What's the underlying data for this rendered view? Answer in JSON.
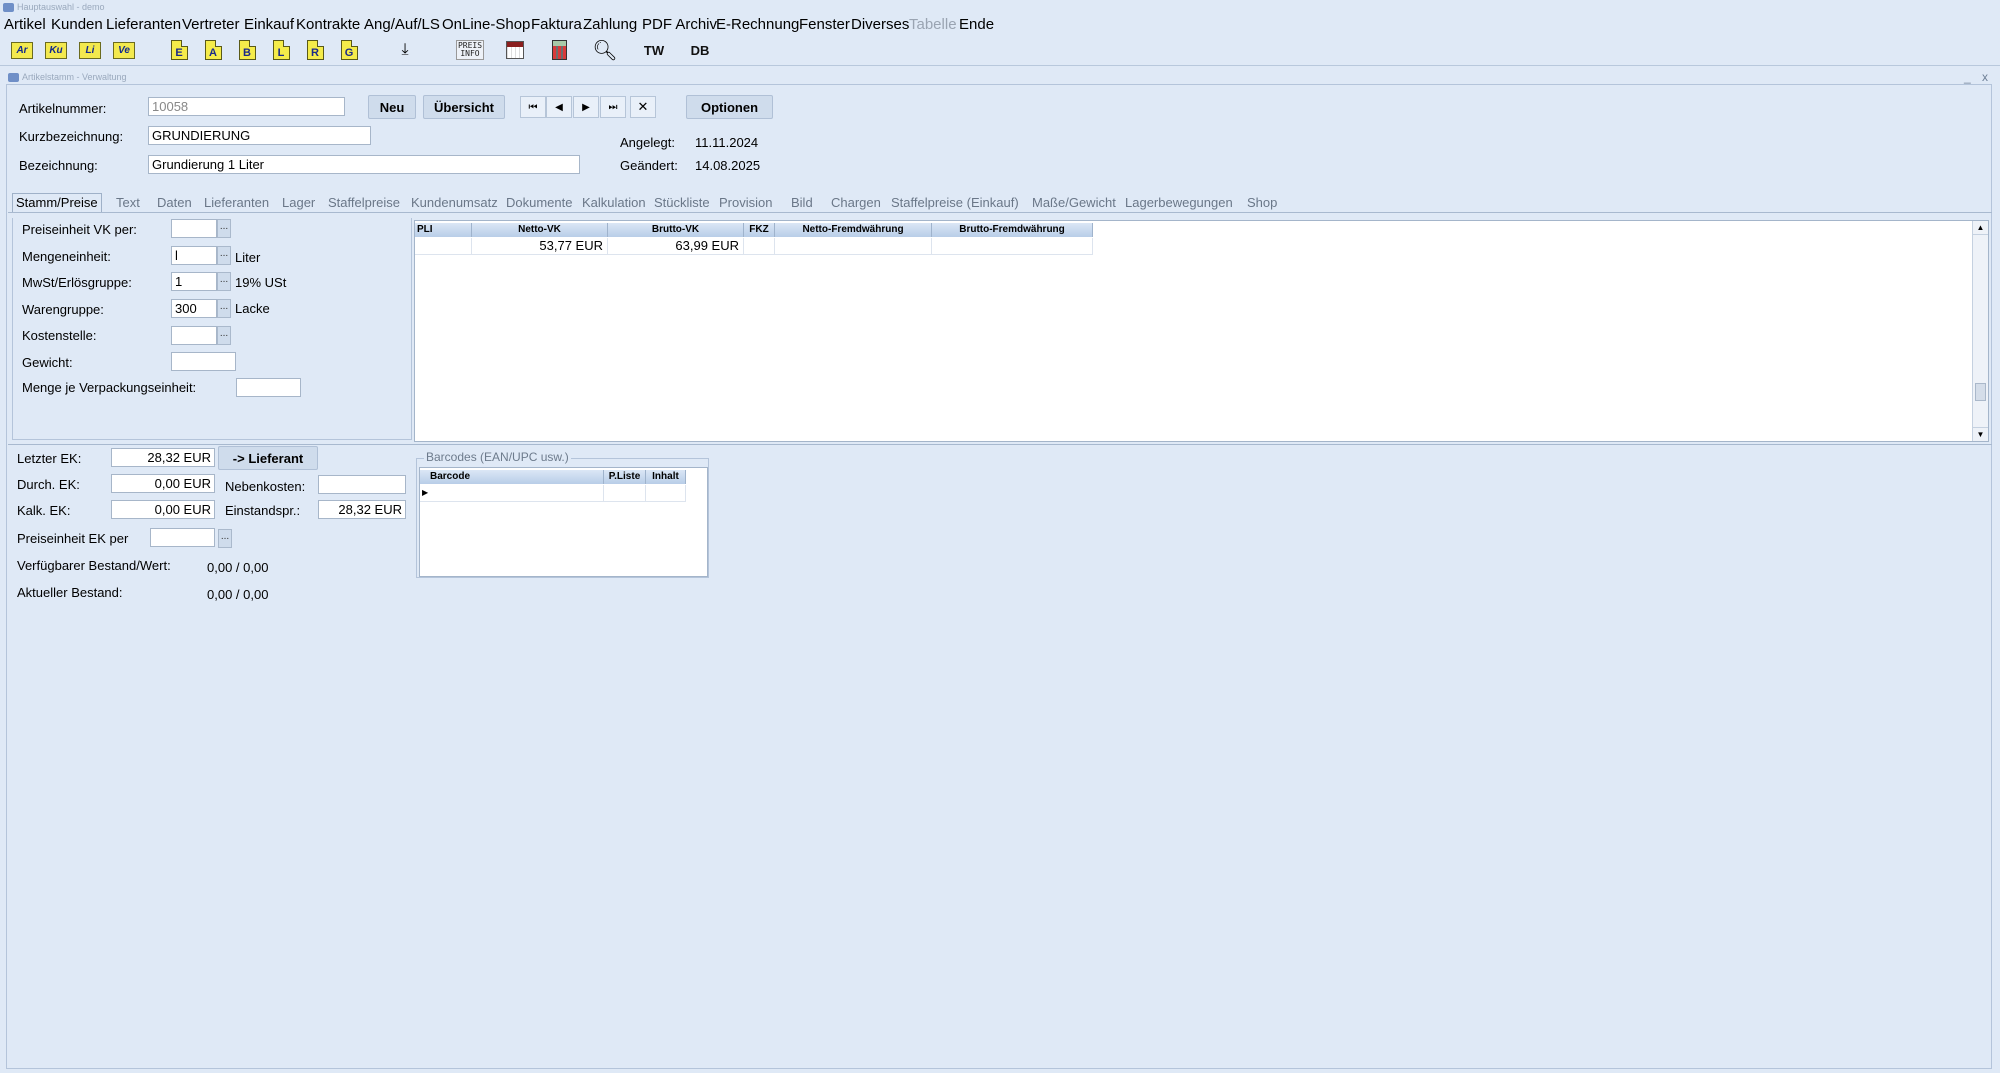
{
  "app": {
    "title": "Hauptauswahl - demo"
  },
  "menu": [
    "Artikel",
    "Kunden",
    "Lieferanten",
    "Vertreter",
    "Einkauf",
    "Kontrakte",
    "Ang/Auf/LS",
    "OnLine-Shop",
    "Faktura",
    "Zahlung",
    "PDF Archiv",
    "E-Rechnung",
    "Fenster",
    "Diverses",
    "Tabelle",
    "Ende"
  ],
  "toolbar": {
    "ar": "Ar",
    "ku": "Ku",
    "li": "Li",
    "ve": "Ve",
    "e": "E",
    "a": "A",
    "b": "B",
    "l": "L",
    "r": "R",
    "g": "G",
    "preis": "PREIS",
    "info": "INFO",
    "tw": "TW",
    "db": "DB"
  },
  "window": {
    "title": "Artikelstamm - Verwaltung",
    "minimize": "_",
    "close": "x"
  },
  "header": {
    "artikelnummer_label": "Artikelnummer:",
    "artikelnummer": "10058",
    "kurz_label": "Kurzbezeichnung:",
    "kurz": "GRUNDIERUNG",
    "bez_label": "Bezeichnung:",
    "bez": "Grundierung 1 Liter",
    "neu": "Neu",
    "uebersicht": "Übersicht",
    "optionen": "Optionen",
    "angelegt_label": "Angelegt:",
    "angelegt": "11.11.2024",
    "geaendert_label": "Geändert:",
    "geaendert": "14.08.2025"
  },
  "tabs": [
    "Stamm/Preise",
    "Text",
    "Daten",
    "Lieferanten",
    "Lager",
    "Staffelpreise",
    "Kundenumsatz",
    "Dokumente",
    "Kalkulation",
    "Stückliste",
    "Provision",
    "Bild",
    "Chargen",
    "Staffelpreise (Einkauf)",
    "Maße/Gewicht",
    "Lagerbewegungen",
    "Shop"
  ],
  "stamm": {
    "pe_vk_label": "Preiseinheit VK per:",
    "pe_vk": "",
    "me_label": "Mengeneinheit:",
    "me": "l",
    "me_text": "Liter",
    "mwst_label": "MwSt/Erlösgruppe:",
    "mwst": "1",
    "mwst_text": "19% USt",
    "wg_label": "Warengruppe:",
    "wg": "300",
    "wg_text": "Lacke",
    "ks_label": "Kostenstelle:",
    "ks": "",
    "gewicht_label": "Gewicht:",
    "gewicht": "",
    "menge_label": "Menge je Verpackungseinheit:",
    "menge": ""
  },
  "price_table": {
    "columns": [
      "PLI",
      "Netto-VK",
      "Brutto-VK",
      "FKZ",
      "Netto-Fremdwährung",
      "Brutto-Fremdwährung"
    ],
    "rows": [
      [
        "",
        "53,77 EUR",
        "63,99 EUR",
        "",
        "",
        ""
      ]
    ]
  },
  "einkauf": {
    "letzter_label": "Letzter EK:",
    "letzter": "28,32 EUR",
    "lieferant_btn": "-> Lieferant",
    "durch_label": "Durch. EK:",
    "durch": "0,00 EUR",
    "neben_label": "Nebenkosten:",
    "neben": "",
    "kalk_label": "Kalk. EK:",
    "kalk": "0,00 EUR",
    "einstand_label": "Einstandspr.:",
    "einstand": "28,32 EUR",
    "pe_ek_label": "Preiseinheit  EK per",
    "pe_ek": "",
    "verf_label": "Verfügbarer Bestand/Wert:",
    "verf": "0,00 / 0,00",
    "akt_label": "Aktueller Bestand:",
    "akt": "0,00 / 0,00"
  },
  "barcodes": {
    "title": "Barcodes (EAN/UPC usw.)",
    "columns": [
      "Barcode",
      "P.Liste",
      "Inhalt"
    ]
  }
}
